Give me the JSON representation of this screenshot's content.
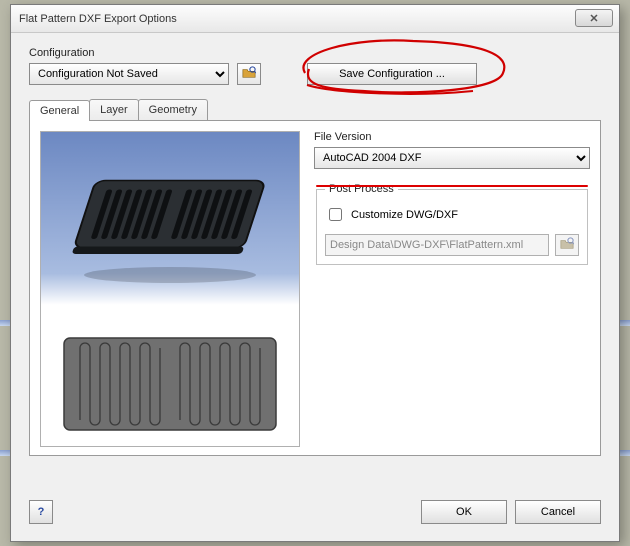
{
  "dialog": {
    "title": "Flat Pattern DXF Export Options",
    "close_glyph": "✕"
  },
  "config": {
    "label": "Configuration",
    "dropdown_value": "Configuration Not Saved",
    "browse_icon": "open-folder-icon",
    "save_button_label": "Save Configuration ..."
  },
  "tabs": [
    {
      "label": "General",
      "active": true
    },
    {
      "label": "Layer",
      "active": false
    },
    {
      "label": "Geometry",
      "active": false
    }
  ],
  "general": {
    "file_version_label": "File Version",
    "file_version_value": "AutoCAD 2004 DXF",
    "post_process": {
      "legend": "Post Process",
      "checkbox_label": "Customize DWG/DXF",
      "checkbox_checked": false,
      "path_value": "Design Data\\DWG-DXF\\FlatPattern.xml",
      "path_browse_icon": "open-folder-icon"
    }
  },
  "footer": {
    "help_glyph": "?",
    "ok_label": "OK",
    "cancel_label": "Cancel"
  }
}
